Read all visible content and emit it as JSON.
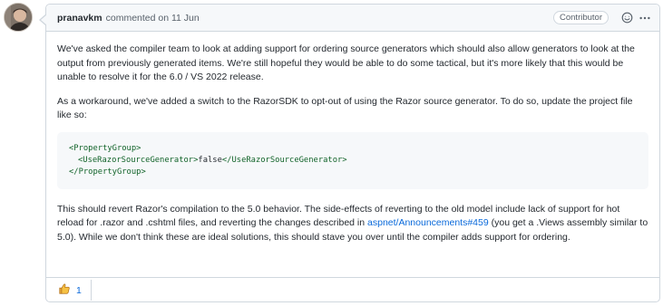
{
  "comment": {
    "author": "pranavkm",
    "meta": "commented on 11 Jun",
    "badge": "Contributor",
    "paragraph1": "We've asked the compiler team to look at adding support for ordering source generators which should also allow generators to look at the output from previously generated items. We're still hopeful they would be able to do some tactical, but it's more likely that this would be unable to resolve it for the 6.0 / VS 2022 release.",
    "paragraph2": "As a workaround, we've added a switch to the RazorSDK to opt-out of using the Razor source generator. To do so, update the project file like so:",
    "code": {
      "open_tag": "<PropertyGroup>",
      "inner_open_tag": "<UseRazorSourceGenerator>",
      "inner_value": "false",
      "inner_close_tag": "</UseRazorSourceGenerator>",
      "close_tag": "</PropertyGroup>"
    },
    "paragraph3_before": "This should revert Razor's compilation to the 5.0 behavior. The side-effects of reverting to the old model include lack of support for hot reload for .razor and .cshtml files, and reverting the changes described in ",
    "paragraph3_link": "aspnet/Announcements#459",
    "paragraph3_after": " (you get a .Views assembly similar to 5.0). While we don't think these are ideal solutions, this should stave you over until the compiler adds support for ordering.",
    "reaction": {
      "icon": "thumbs-up-icon",
      "count": "1"
    }
  },
  "icons": {
    "emoji_button": "smiley-icon",
    "more_button": "kebab-horizontal-icon"
  },
  "colors": {
    "link": "#0969da",
    "code_tag": "#116329",
    "header_bg": "#f6f8fa",
    "border": "#d0d7de"
  }
}
